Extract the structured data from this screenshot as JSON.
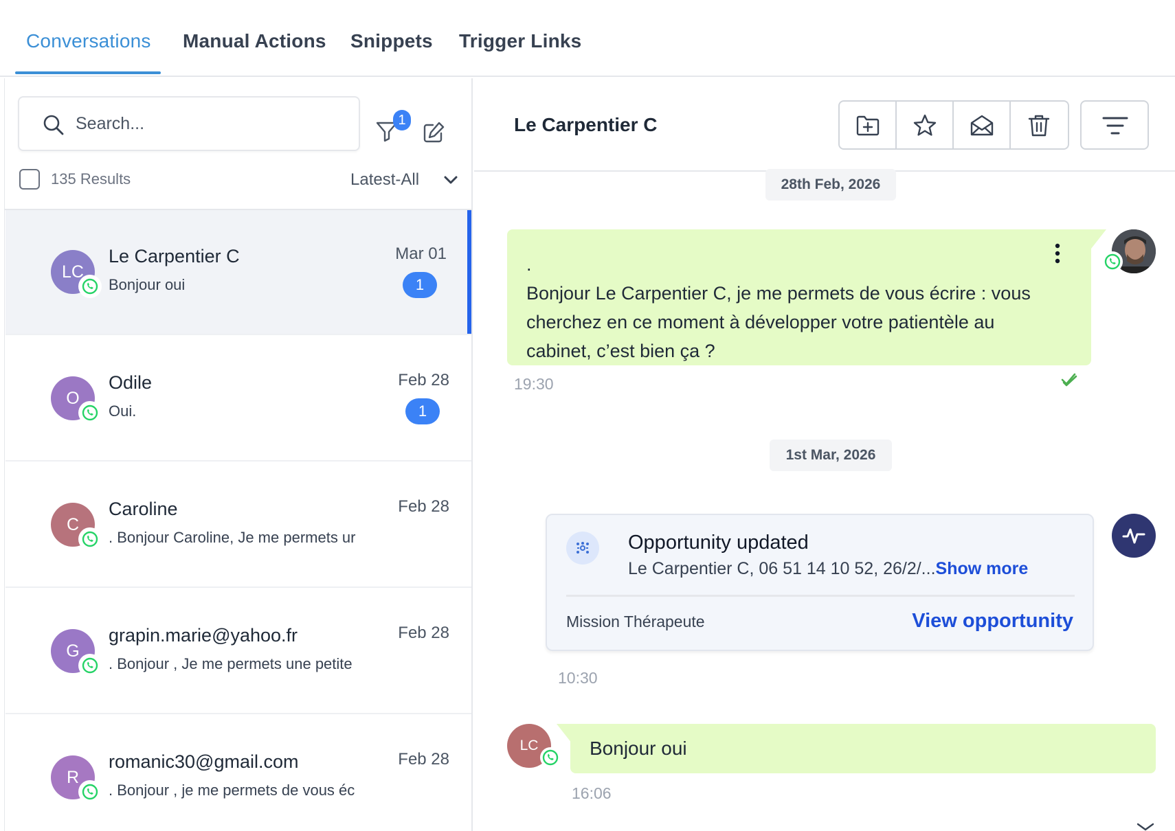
{
  "tabs": [
    {
      "label": "Conversations",
      "active": true
    },
    {
      "label": "Manual Actions",
      "active": false
    },
    {
      "label": "Snippets",
      "active": false
    },
    {
      "label": "Trigger Links",
      "active": false
    }
  ],
  "sidebar": {
    "search_placeholder": "Search...",
    "filter_count": "1",
    "results": "135 Results",
    "sort": "Latest-All",
    "conversations": [
      {
        "initials": "LC",
        "name": "Le Carpentier C",
        "preview": "Bonjour oui",
        "date": "Mar 01",
        "unread": "1",
        "avatar_color": "#8a7fc8",
        "selected": true
      },
      {
        "initials": "O",
        "name": "Odile",
        "preview": "Oui.",
        "date": "Feb 28",
        "unread": "1",
        "avatar_color": "#9b78c4",
        "selected": false
      },
      {
        "initials": "C",
        "name": "Caroline",
        "preview": ". Bonjour Caroline, Je me permets ur",
        "date": "Feb 28",
        "unread": "",
        "avatar_color": "#b7737c",
        "selected": false
      },
      {
        "initials": "G",
        "name": "grapin.marie@yahoo.fr",
        "preview": ". Bonjour , Je me permets une petite",
        "date": "Feb 28",
        "unread": "",
        "avatar_color": "#9a78c6",
        "selected": false
      },
      {
        "initials": "R",
        "name": "romanic30@gmail.com",
        "preview": ". Bonjour , je me permets de vous éc",
        "date": "Feb 28",
        "unread": "",
        "avatar_color": "#a678c2",
        "selected": false
      }
    ]
  },
  "chat": {
    "contact_name": "Le Carpentier C",
    "toolbar_icons": [
      "folder-plus-icon",
      "star-icon",
      "envelope-open-icon",
      "trash-icon"
    ],
    "date_1": "28th Feb, 2026",
    "outgoing_message": ".\nBonjour Le Carpentier C, je me permets de vous écrire : vous cherchez en ce moment à développer votre patientèle au cabinet, c’est bien ça ?",
    "outgoing_time": "19:30",
    "date_2": "1st Mar, 2026",
    "opportunity": {
      "title": "Opportunity updated",
      "description": "Le Carpentier C, 06 51 14 10 52, 26/2/...",
      "show_more": "Show more",
      "pipeline": "Mission Thérapeute",
      "view_link": "View opportunity",
      "time": "10:30"
    },
    "incoming_initials": "LC",
    "incoming_message": "Bonjour oui",
    "incoming_time": "16:06"
  },
  "colors": {
    "accent": "#3b8fd6",
    "badge": "#3b82f6",
    "bubble": "#e5fbc6",
    "whatsapp": "#25d366",
    "link": "#1d4ed8"
  }
}
